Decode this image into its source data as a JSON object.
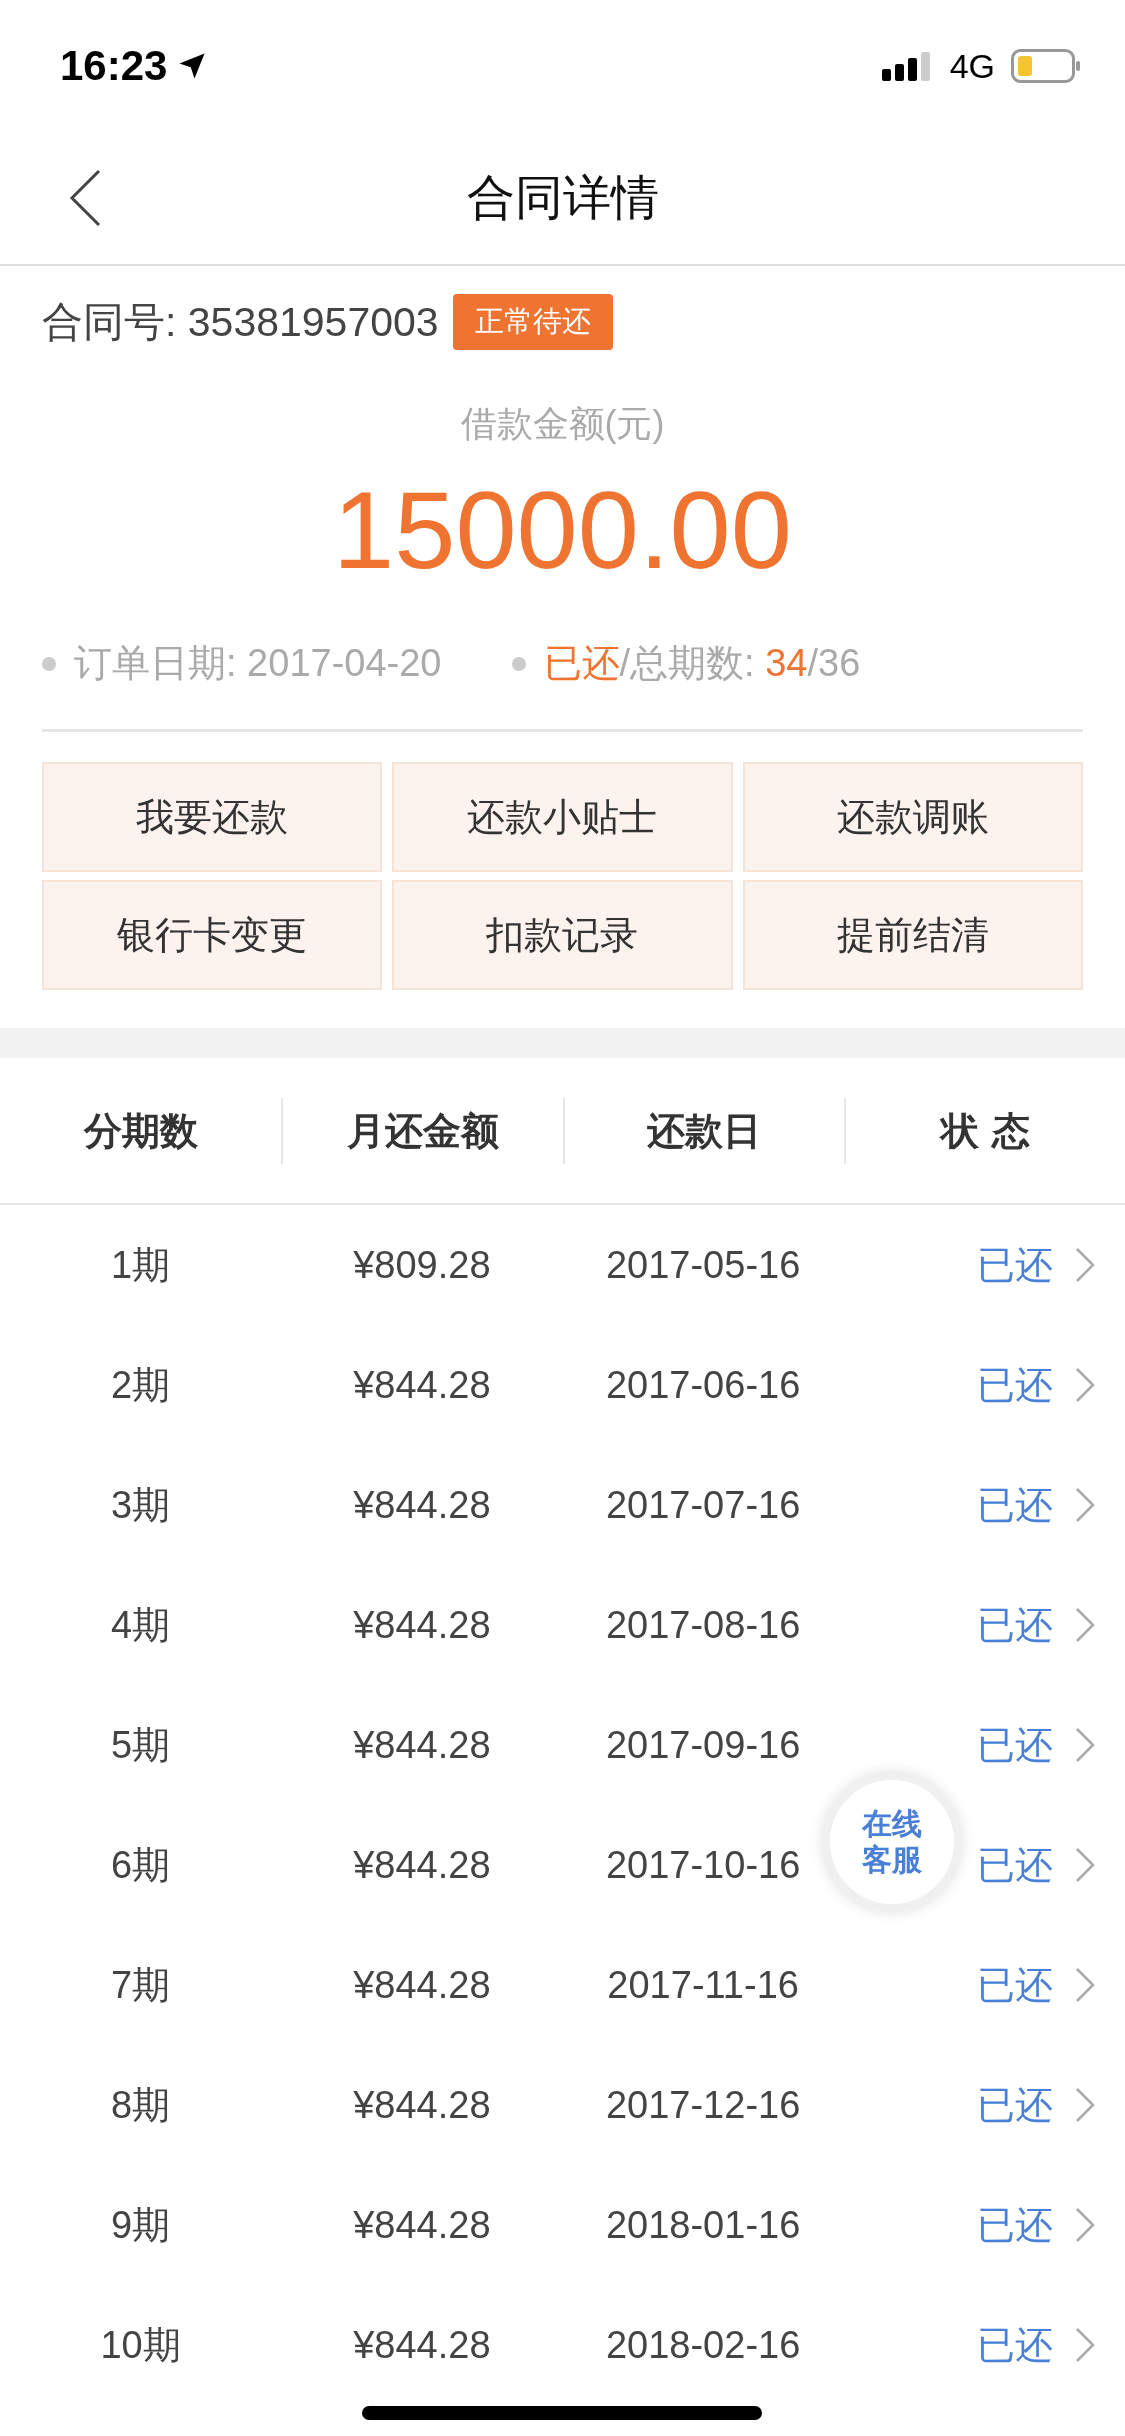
{
  "status_bar": {
    "time": "16:23",
    "network": "4G"
  },
  "nav": {
    "title": "合同详情"
  },
  "contract": {
    "label": "合同号: 35381957003",
    "badge": "正常待还"
  },
  "loan": {
    "label": "借款金额(元)",
    "amount": "15000.00"
  },
  "info": [
    [
      {
        "text": "订单日期: 2017-04-20",
        "highlight": false
      }
    ],
    [
      {
        "text": "已还",
        "highlight": true
      },
      {
        "text": "/总期数: ",
        "highlight": false
      },
      {
        "text": "34",
        "highlight": true
      },
      {
        "text": "/36",
        "highlight": false
      }
    ]
  ],
  "actions": [
    "我要还款",
    "还款小贴士",
    "还款调账",
    "银行卡变更",
    "扣款记录",
    "提前结清"
  ],
  "table": {
    "columns": [
      "分期数",
      "月还金额",
      "还款日",
      "状 态"
    ],
    "rows": [
      {
        "period": "1期",
        "amount": "¥809.28",
        "date": "2017-05-16",
        "status": "已还"
      },
      {
        "period": "2期",
        "amount": "¥844.28",
        "date": "2017-06-16",
        "status": "已还"
      },
      {
        "period": "3期",
        "amount": "¥844.28",
        "date": "2017-07-16",
        "status": "已还"
      },
      {
        "period": "4期",
        "amount": "¥844.28",
        "date": "2017-08-16",
        "status": "已还"
      },
      {
        "period": "5期",
        "amount": "¥844.28",
        "date": "2017-09-16",
        "status": "已还"
      },
      {
        "period": "6期",
        "amount": "¥844.28",
        "date": "2017-10-16",
        "status": "已还"
      },
      {
        "period": "7期",
        "amount": "¥844.28",
        "date": "2017-11-16",
        "status": "已还"
      },
      {
        "period": "8期",
        "amount": "¥844.28",
        "date": "2017-12-16",
        "status": "已还"
      },
      {
        "period": "9期",
        "amount": "¥844.28",
        "date": "2018-01-16",
        "status": "已还"
      },
      {
        "period": "10期",
        "amount": "¥844.28",
        "date": "2018-02-16",
        "status": "已还"
      }
    ]
  },
  "support_button": {
    "lines": [
      "在线",
      "客服"
    ]
  }
}
